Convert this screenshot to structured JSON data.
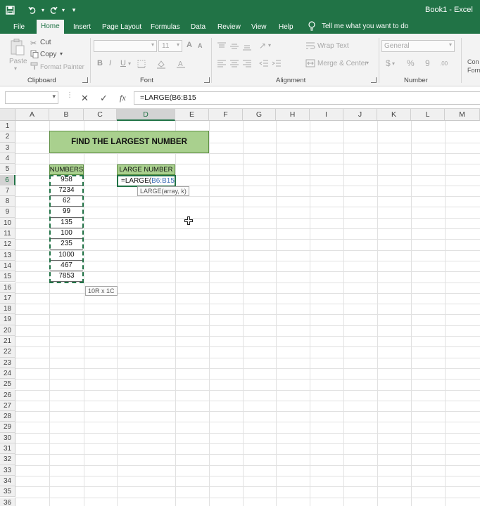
{
  "window": {
    "title": "Book1 - Excel"
  },
  "tabs": [
    {
      "label": "File"
    },
    {
      "label": "Home"
    },
    {
      "label": "Insert"
    },
    {
      "label": "Page Layout"
    },
    {
      "label": "Formulas"
    },
    {
      "label": "Data"
    },
    {
      "label": "Review"
    },
    {
      "label": "View"
    },
    {
      "label": "Help"
    }
  ],
  "tell_me": "Tell me what you want to do",
  "ribbon": {
    "clipboard": {
      "paste": "Paste",
      "cut": "Cut",
      "copy": "Copy",
      "format_painter": "Format Painter",
      "label": "Clipboard"
    },
    "font": {
      "size": "11",
      "bold": "B",
      "italic": "I",
      "underline": "U",
      "grow": "A",
      "shrink": "A",
      "label": "Font"
    },
    "alignment": {
      "wrap": "Wrap Text",
      "merge": "Merge & Center",
      "label": "Alignment"
    },
    "number": {
      "format": "General",
      "currency": "$",
      "percent": "%",
      "comma": "9",
      "label": "Number"
    },
    "conditional": "Con Form"
  },
  "formula_bar": {
    "name_box": "",
    "cancel": "✕",
    "enter": "✓",
    "fx": "fx",
    "formula": "=LARGE(B6:B15"
  },
  "columns": [
    "A",
    "B",
    "C",
    "D",
    "E",
    "F",
    "G",
    "H",
    "I",
    "J",
    "K",
    "L",
    "M"
  ],
  "rows": [
    "1",
    "2",
    "3",
    "4",
    "5",
    "6",
    "7",
    "8",
    "9",
    "10",
    "11",
    "12",
    "13",
    "14",
    "15",
    "16",
    "17",
    "18",
    "19",
    "20",
    "21",
    "22",
    "23",
    "24",
    "25",
    "26",
    "27",
    "28",
    "29",
    "30",
    "31",
    "32",
    "33",
    "34",
    "35",
    "36"
  ],
  "sheet": {
    "title": "FIND THE LARGEST NUMBER",
    "numbers_header": "NUMBERS",
    "large_header": "LARGE NUMBER",
    "numbers": [
      "958",
      "7234",
      "62",
      "99",
      "135",
      "100",
      "235",
      "1000",
      "467",
      "7853"
    ],
    "active_prefix": "=LARGE(",
    "active_ref": "B6:B15",
    "tooltip": "LARGE(array, k)",
    "selection_size": "10R x 1C"
  }
}
